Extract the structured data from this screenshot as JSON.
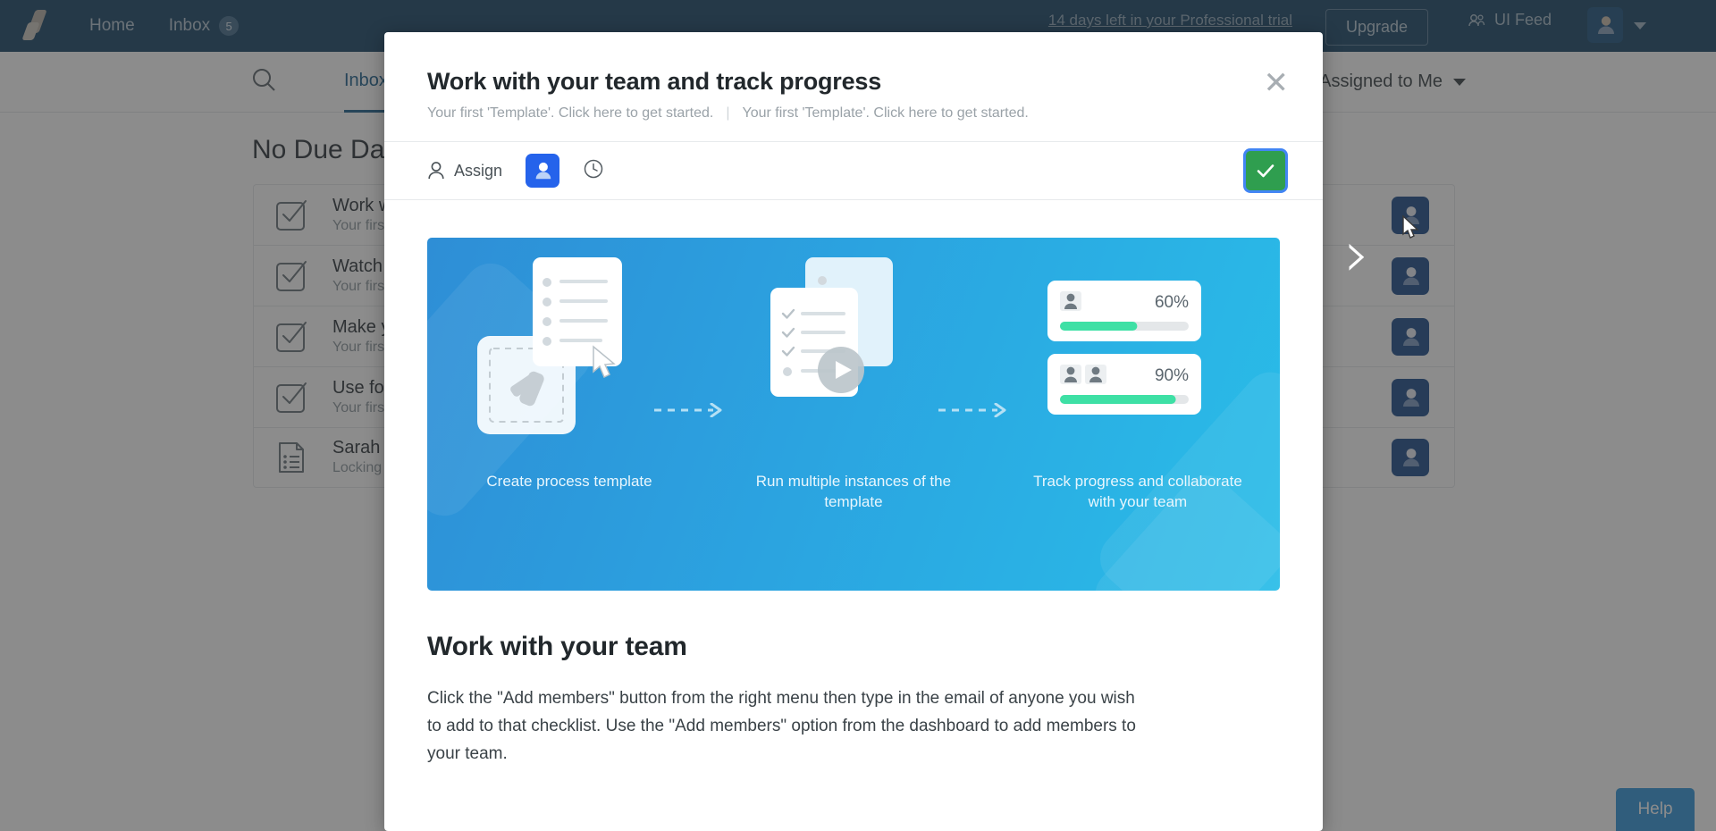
{
  "nav": {
    "brand": "brand-logo",
    "home_label": "Home",
    "inbox_label": "Inbox",
    "inbox_count": "5",
    "trial_text": "14 days left in your Professional trial",
    "upgrade_label": "Upgrade",
    "ui_feed_label": "UI Feed"
  },
  "subheader": {
    "tab_inbox": "Inbox",
    "assigned_filter": "Assigned to Me"
  },
  "list": {
    "section_title": "No Due Date",
    "rows": [
      {
        "title": "Work with your team and track progress",
        "subtitle": "Your first 'Template'. Click here to get started.",
        "icon": "checkbox-icon"
      },
      {
        "title": "Watch a quick video to get started",
        "subtitle": "Your first 'Template'. Click here to get started.",
        "icon": "checkbox-icon"
      },
      {
        "title": "Make your first template",
        "subtitle": "Your first 'Template'. Click here to get started.",
        "icon": "checkbox-icon"
      },
      {
        "title": "Use form fields to collect data",
        "subtitle": "Your first 'Template'. Click here to get started.",
        "icon": "checkbox-icon"
      },
      {
        "title": "Sarah Jones onboarding",
        "subtitle": "Locking up the office",
        "icon": "document-icon"
      }
    ]
  },
  "help": {
    "label": "Help"
  },
  "modal": {
    "title": "Work with your team and track progress",
    "subtitle_left": "Your first 'Template'. Click here to get started.",
    "subtitle_divider": "|",
    "subtitle_right": "Your first 'Template'. Click here to get started.",
    "close_label": "✕",
    "toolbar": {
      "assign_label": "Assign",
      "avatar_icon": "user-avatar-icon",
      "clock_icon": "clock-icon",
      "confirm_icon": "check-icon"
    },
    "illustration": {
      "panels": [
        {
          "caption": "Create process template"
        },
        {
          "caption": "Run multiple instances of the template"
        },
        {
          "caption": "Track progress and collaborate with your team"
        }
      ],
      "progress_cards": [
        {
          "value": "60%",
          "percent": 60
        },
        {
          "value": "90%",
          "percent": 90
        }
      ]
    },
    "body_heading": "Work with your team",
    "body_paragraph": "Click the \"Add members\" button from the right menu then type in the email of anyone you wish to add to that checklist. Use the \"Add members\" option from the dashboard to add members to your team."
  },
  "colors": {
    "nav_bg": "#1b4869",
    "accent_blue": "#2563eb",
    "confirm_green": "#2f9e4f",
    "focus_ring": "#4285f4",
    "help_blue": "#3498db",
    "progress_green": "#3ee0a5"
  }
}
